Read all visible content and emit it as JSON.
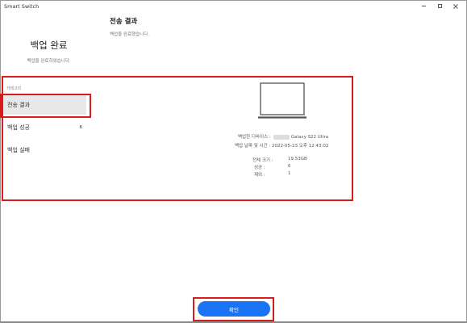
{
  "window": {
    "title": "Smart Switch"
  },
  "left_header": {
    "title": "백업 완료",
    "subtitle": "백업을 완료하였습니다."
  },
  "main_header": {
    "title": "전송 결과",
    "subtitle": "백업을 완료했습니다."
  },
  "sidebar": {
    "category_label": "카테고리",
    "items": [
      {
        "label": "전송 결과",
        "count": "",
        "selected": true
      },
      {
        "label": "백업 성공",
        "count": "6",
        "selected": false
      },
      {
        "label": "백업 실패",
        "count": "",
        "selected": false
      }
    ]
  },
  "details": {
    "device_label": "백업한 디바이스 :",
    "device_name": "Galaxy S22 Ultra",
    "date_label": "백업 날짜 및 시간 :",
    "date_value": "2022-05-23 오후 12:43:02",
    "total_size_label": "전체 크기 :",
    "total_size_value": "19.53GB",
    "success_label": "성공 :",
    "success_value": "6",
    "excluded_label": "제외 :",
    "excluded_value": "1"
  },
  "footer": {
    "confirm_label": "확인"
  },
  "colors": {
    "accent": "#1a73f5",
    "highlight": "#d81c1c"
  }
}
